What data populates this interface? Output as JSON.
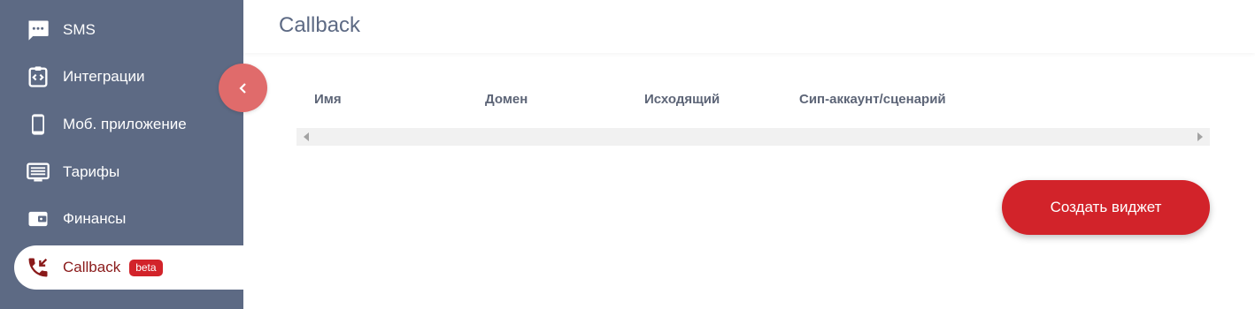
{
  "sidebar": {
    "items": [
      {
        "label": "SMS",
        "icon": "sms-icon"
      },
      {
        "label": "Интеграции",
        "icon": "integration-icon"
      },
      {
        "label": "Моб. приложение",
        "icon": "mobile-phone-icon"
      },
      {
        "label": "Тарифы",
        "icon": "tariff-list-icon"
      },
      {
        "label": "Финансы",
        "icon": "wallet-icon"
      },
      {
        "label": "Callback",
        "icon": "callback-phone-icon",
        "badge": "beta",
        "active": true
      }
    ]
  },
  "header": {
    "title": "Callback"
  },
  "table": {
    "columns": [
      "Имя",
      "Домен",
      "Исходящий",
      "Сип-аккаунт/сценарий"
    ]
  },
  "actions": {
    "create_label": "Создать виджет"
  },
  "colors": {
    "sidebar_bg": "#5d6a84",
    "accent": "#d2232a",
    "collapse_button": "#e06b6b"
  }
}
